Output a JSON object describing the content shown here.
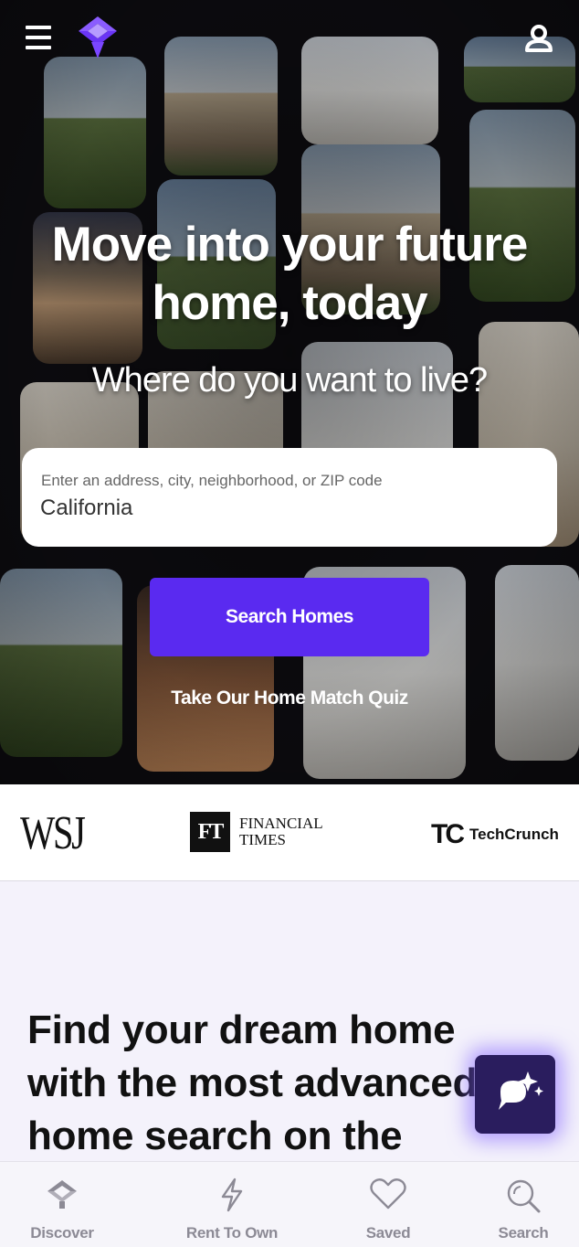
{
  "hero": {
    "title": "Move into your future home, today",
    "subtitle": "Where do you want to live?",
    "search": {
      "placeholder": "Enter an address, city, neighborhood, or ZIP code",
      "value": "California"
    },
    "search_button": "Search Homes",
    "quiz_link": "Take Our Home Match Quiz"
  },
  "press": {
    "wsj": "WSJ",
    "ft_mark": "FT",
    "ft_name_line1": "FINANCIAL",
    "ft_name_line2": "TIMES",
    "tc_mark": "TC",
    "tc_name": "TechCrunch"
  },
  "content": {
    "heading_line1": "Find your dream home",
    "heading_line2": "with the most advanced",
    "heading_line3": "home search on the"
  },
  "bottom_nav": [
    {
      "label": "Discover",
      "icon": "home-icon"
    },
    {
      "label": "Rent To Own",
      "icon": "bolt-icon"
    },
    {
      "label": "Saved",
      "icon": "heart-icon"
    },
    {
      "label": "Search",
      "icon": "search-icon"
    }
  ],
  "colors": {
    "accent": "#5a2af0",
    "fab": "#2a1d5e",
    "nav_text": "#8c8a95"
  }
}
